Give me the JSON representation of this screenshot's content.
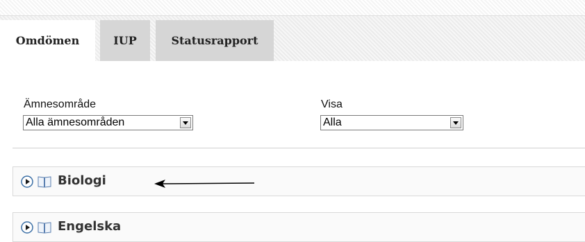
{
  "tabs": [
    {
      "label": "Omdömen",
      "active": true
    },
    {
      "label": "IUP",
      "active": false
    },
    {
      "label": "Statusrapport",
      "active": false
    }
  ],
  "filters": {
    "subject_area": {
      "label": "Ämnesområde",
      "selected": "Alla ämnesområden"
    },
    "show": {
      "label": "Visa",
      "selected": "Alla"
    }
  },
  "subjects": [
    {
      "name": "Biologi",
      "icons": [
        "expand-play-icon",
        "book-icon"
      ]
    },
    {
      "name": "Engelska",
      "icons": [
        "expand-play-icon",
        "book-icon"
      ]
    }
  ],
  "colors": {
    "active_tab": "#ffffff",
    "inactive_tab": "#d6d6d6",
    "accent_icon": "#3a6ea5"
  }
}
